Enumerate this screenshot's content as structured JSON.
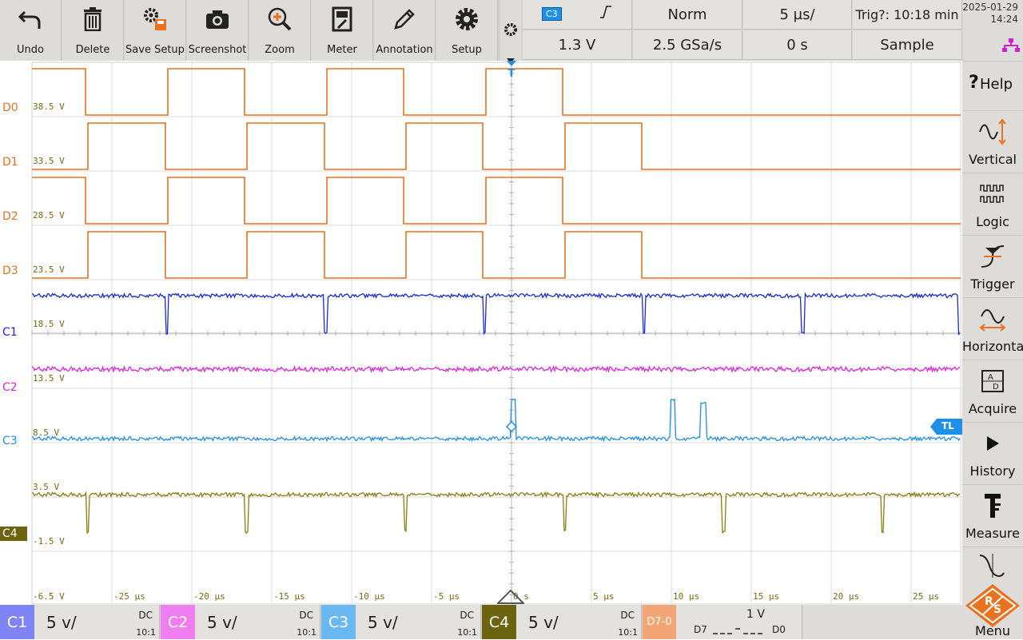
{
  "toolbar": {
    "buttons": [
      {
        "label": "Undo",
        "icon": "undo-icon"
      },
      {
        "label": "Delete",
        "icon": "trash-icon"
      },
      {
        "label": "Save Setup",
        "icon": "save-setup-icon"
      },
      {
        "label": "Screenshot",
        "icon": "camera-icon"
      },
      {
        "label": "Zoom",
        "icon": "zoom-icon"
      },
      {
        "label": "Meter",
        "icon": "meter-icon"
      },
      {
        "label": "Annotation",
        "icon": "pencil-icon"
      },
      {
        "label": "Setup",
        "icon": "gear-icon"
      }
    ]
  },
  "info": {
    "trigger_source": "C3",
    "trigger_level": "1.3 V",
    "trigger_mode": "Norm",
    "sample_rate": "2.5 GSa/s",
    "timebase": "5 µs/",
    "horizontal_position": "0 s",
    "trigger_count": "Trig?: 10:18 min",
    "acquisition_mode": "Sample"
  },
  "status": {
    "date": "2025-01-29",
    "time": "14:24"
  },
  "side_menu": [
    {
      "label": "Help",
      "icon": "help-icon"
    },
    {
      "label": "Vertical",
      "icon": "vertical-icon"
    },
    {
      "label": "Logic",
      "icon": "logic-icon"
    },
    {
      "label": "Trigger",
      "icon": "trigger-icon"
    },
    {
      "label": "Horizontal",
      "icon": "horizontal-icon"
    },
    {
      "label": "Acquire",
      "icon": "acquire-icon"
    },
    {
      "label": "History",
      "icon": "play-icon"
    },
    {
      "label": "Measure",
      "icon": "measure-icon"
    },
    {
      "label": "Menu",
      "icon": "rs-logo-icon"
    }
  ],
  "waveform": {
    "channels": [
      {
        "label": "D0",
        "color": "#e8721f",
        "kind": "digital"
      },
      {
        "label": "D1",
        "color": "#e8721f",
        "kind": "digital"
      },
      {
        "label": "D2",
        "color": "#e8721f",
        "kind": "digital"
      },
      {
        "label": "D3",
        "color": "#e8721f",
        "kind": "digital"
      },
      {
        "label": "C1",
        "color": "#1a2ad6",
        "kind": "analog"
      },
      {
        "label": "C2",
        "color": "#e024e0",
        "kind": "analog"
      },
      {
        "label": "C3",
        "color": "#1e90e8",
        "kind": "analog"
      },
      {
        "label": "C4",
        "color": "#8a7d10",
        "kind": "analog"
      }
    ],
    "voltage_labels": [
      "38.5 V",
      "33.5 V",
      "28.5 V",
      "23.5 V",
      "18.5 V",
      "13.5 V",
      "8.5 V",
      "3.5 V",
      "-1.5 V",
      "-6.5 V"
    ],
    "time_labels": [
      "-25 µs",
      "-20 µs",
      "-15 µs",
      "-10 µs",
      "-5 µs",
      "0 s",
      "5 µs",
      "10 µs",
      "15 µs",
      "20 µs",
      "25 µs"
    ],
    "trigger_marker": "T",
    "trigger_level_marker": "TL"
  },
  "bottom": {
    "channels": [
      {
        "label": "C1",
        "scale": "5 v/",
        "coupling": "DC",
        "probe": "10:1",
        "color": "#7f84f5"
      },
      {
        "label": "C2",
        "scale": "5 v/",
        "coupling": "DC",
        "probe": "10:1",
        "color": "#f07ef0"
      },
      {
        "label": "C3",
        "scale": "5 v/",
        "coupling": "DC",
        "probe": "10:1",
        "color": "#6ab8f2"
      },
      {
        "label": "C4",
        "scale": "5 v/",
        "coupling": "DC",
        "probe": "10:1",
        "color": "#6b6310"
      }
    ],
    "logic": {
      "label": "D7-0",
      "threshold": "1 V",
      "high_label": "D7",
      "low_label": "D0",
      "color": "#f4a576"
    }
  }
}
